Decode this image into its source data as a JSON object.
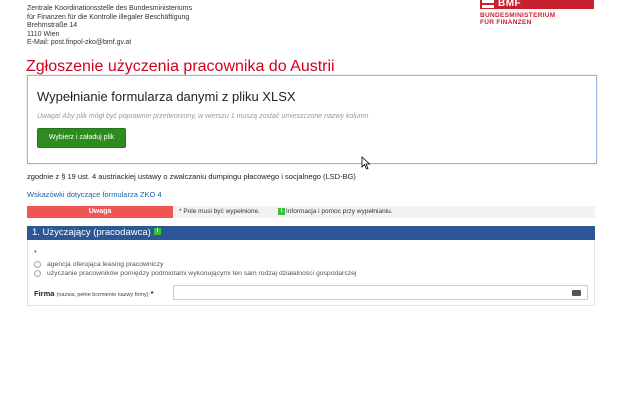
{
  "header": {
    "address_lines": [
      "Zentrale Koordinationsstelle des Bundesministeriums",
      "für Finanzen für die Kontrolle illegaler Beschäftigung",
      "Brehmstraße 14",
      "1110 Wien",
      "E-Mail: post.finpol-zko@bmf.gv.at"
    ],
    "logo": {
      "brand": "BMF",
      "line1": "BUNDESMINISTERIUM",
      "line2": "FÜR FINANZEN",
      "colors": {
        "red": "#c8202e",
        "white": "#ffffff"
      }
    }
  },
  "page_title": "Zgłoszenie użyczenia pracownika do Austrii",
  "upload": {
    "heading": "Wypełnianie formularza danymi z pliku XLSX",
    "warning": "Uwaga! Aby plik mógł być poprawnie przetworzony, w wierszu 1 muszą zostać umieszczone nazwy kolumn",
    "button_label": "Wybierz i załaduj plik",
    "button_color": "#2e8b1f"
  },
  "legal_text": "zgodnie z § 19 ust. 4 austriackiej ustawy o zwalczaniu dumpingu płacowego i socjalnego (LSD-BG)",
  "hints_link": "Wskazówki dotyczące formularza ZKO 4",
  "legend": {
    "warning_label": "Uwaga",
    "required_marker": "*",
    "required_text": "Pole musi być wypełnione.",
    "info_icon": "i",
    "info_text": "Informacja i pomoc przy wypełnianiu.",
    "warning_color": "#f05454",
    "info_color": "#3fbf3f"
  },
  "section1": {
    "title": "1. Użyczający (pracodawca)",
    "info_icon": "i",
    "header_color": "#2b5797",
    "required_marker": "*",
    "radio_options": [
      "agencja oferująca leasing pracowniczy",
      "użyczanie pracowników pomiędzy podmiotami wykonującymi ten sam rodzaj działalności gospodarczej"
    ],
    "firma": {
      "label": "Firma",
      "sublabel": "(nazwa, pełne brzmienie nazwy firmy)",
      "required_marker": "*",
      "value": ""
    }
  }
}
